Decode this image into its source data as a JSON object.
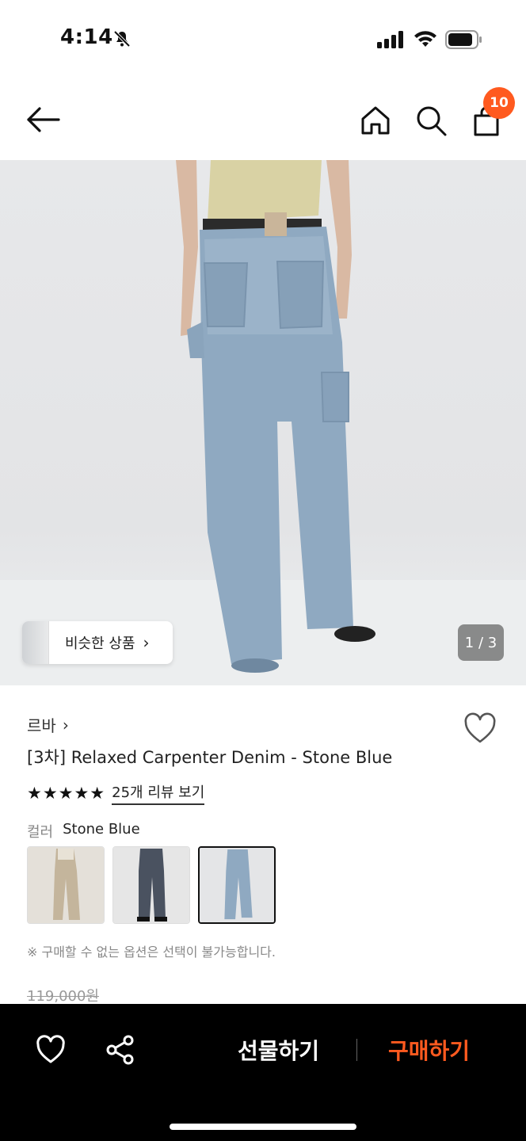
{
  "status": {
    "time": "4:14"
  },
  "header": {
    "cart_count": "10"
  },
  "gallery": {
    "similar_label": "비슷한 상품",
    "counter": "1 / 3"
  },
  "product": {
    "brand": "르바",
    "title": "[3차] Relaxed Carpenter Denim - Stone Blue",
    "rating_stars": "★★★★★",
    "review_link": "25개 리뷰 보기",
    "color_label": "컬러",
    "color_value": "Stone Blue",
    "swatches": [
      "beige",
      "charcoal",
      "stone-blue"
    ],
    "note": "※ 구매할 수 없는 옵션은 선택이 불가능합니다.",
    "original_price": "119,000원"
  },
  "bottom_bar": {
    "gift_label": "선물하기",
    "buy_label": "구매하기"
  },
  "colors": {
    "accent": "#ff5a1f"
  }
}
